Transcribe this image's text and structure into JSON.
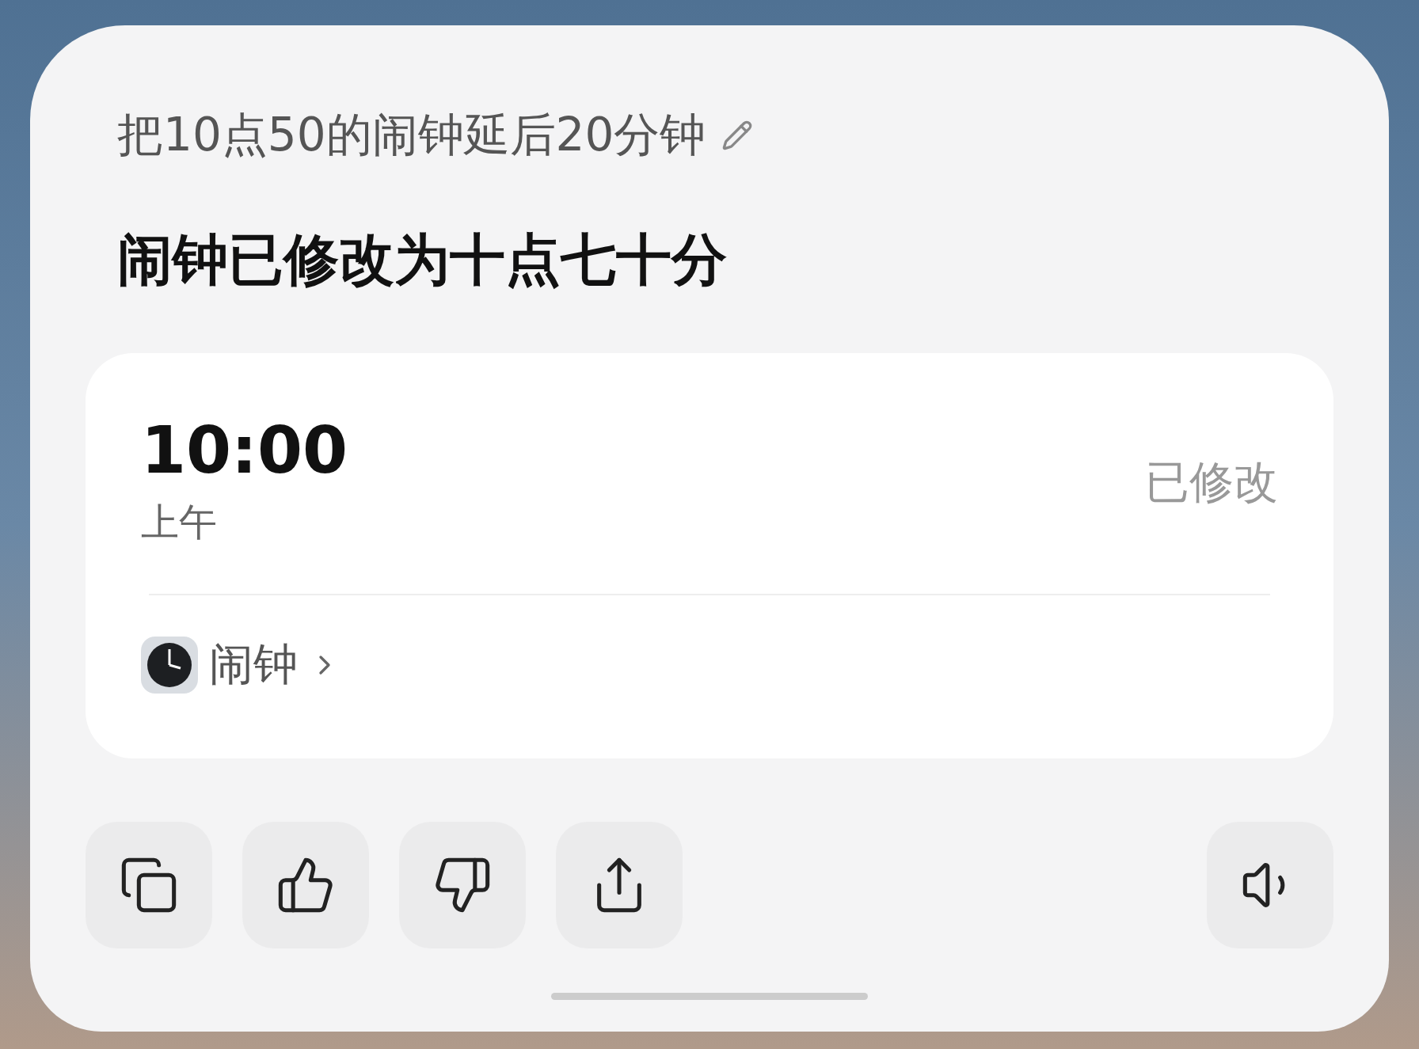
{
  "query": {
    "text": "把10点50的闹钟延后20分钟"
  },
  "answer": "闹钟已修改为十点七十分",
  "alarm": {
    "time": "10:00",
    "period": "上午",
    "status": "已修改"
  },
  "app_link": {
    "label": "闹钟"
  },
  "actions": [
    {
      "kind": "copy"
    },
    {
      "kind": "like"
    },
    {
      "kind": "dislike"
    },
    {
      "kind": "share"
    },
    {
      "kind": "speak"
    }
  ]
}
